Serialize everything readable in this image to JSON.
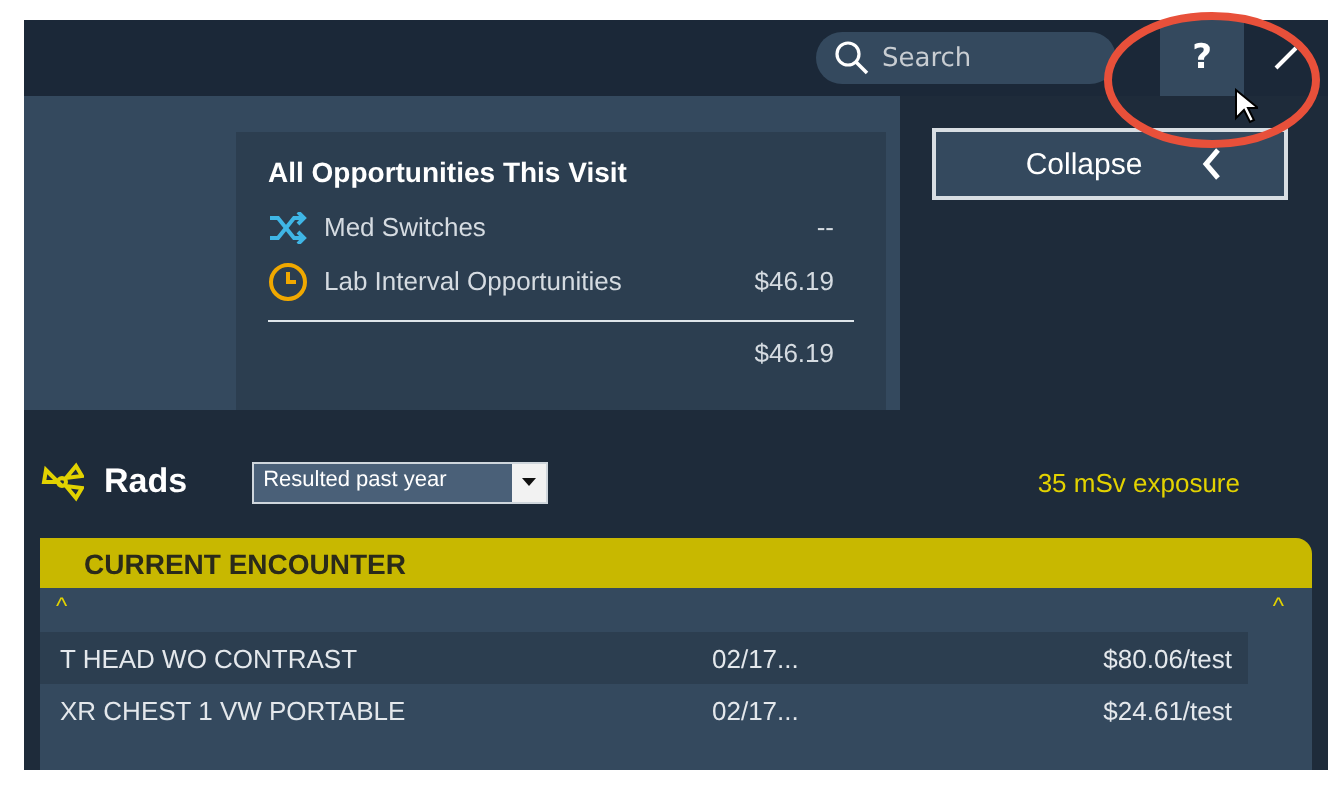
{
  "header": {
    "search": {
      "placeholder": "Search"
    },
    "help_button": {
      "label": "?",
      "selected": true
    }
  },
  "summary": {
    "title": "All Opportunities This Visit",
    "items": [
      {
        "kind": "switch",
        "label": "Med Switches",
        "value": "--"
      },
      {
        "kind": "clock",
        "label": "Lab Interval Opportunities",
        "value": "$46.19"
      }
    ],
    "total": "$46.19"
  },
  "collapse_button": {
    "label": "Collapse"
  },
  "rads": {
    "title": "Rads",
    "filter": {
      "value": "Resulted past year"
    },
    "exposure": "35 mSv exposure",
    "section": "CURRENT ENCOUNTER",
    "sort_marks": [
      "^",
      "^"
    ],
    "rows": [
      {
        "name": "T HEAD WO CONTRAST",
        "date": "02/17...",
        "cost": "$80.06/test",
        "selected": true
      },
      {
        "name": "XR CHEST 1 VW PORTABLE",
        "date": "02/17...",
        "cost": "$24.61/test",
        "selected": false
      }
    ]
  }
}
